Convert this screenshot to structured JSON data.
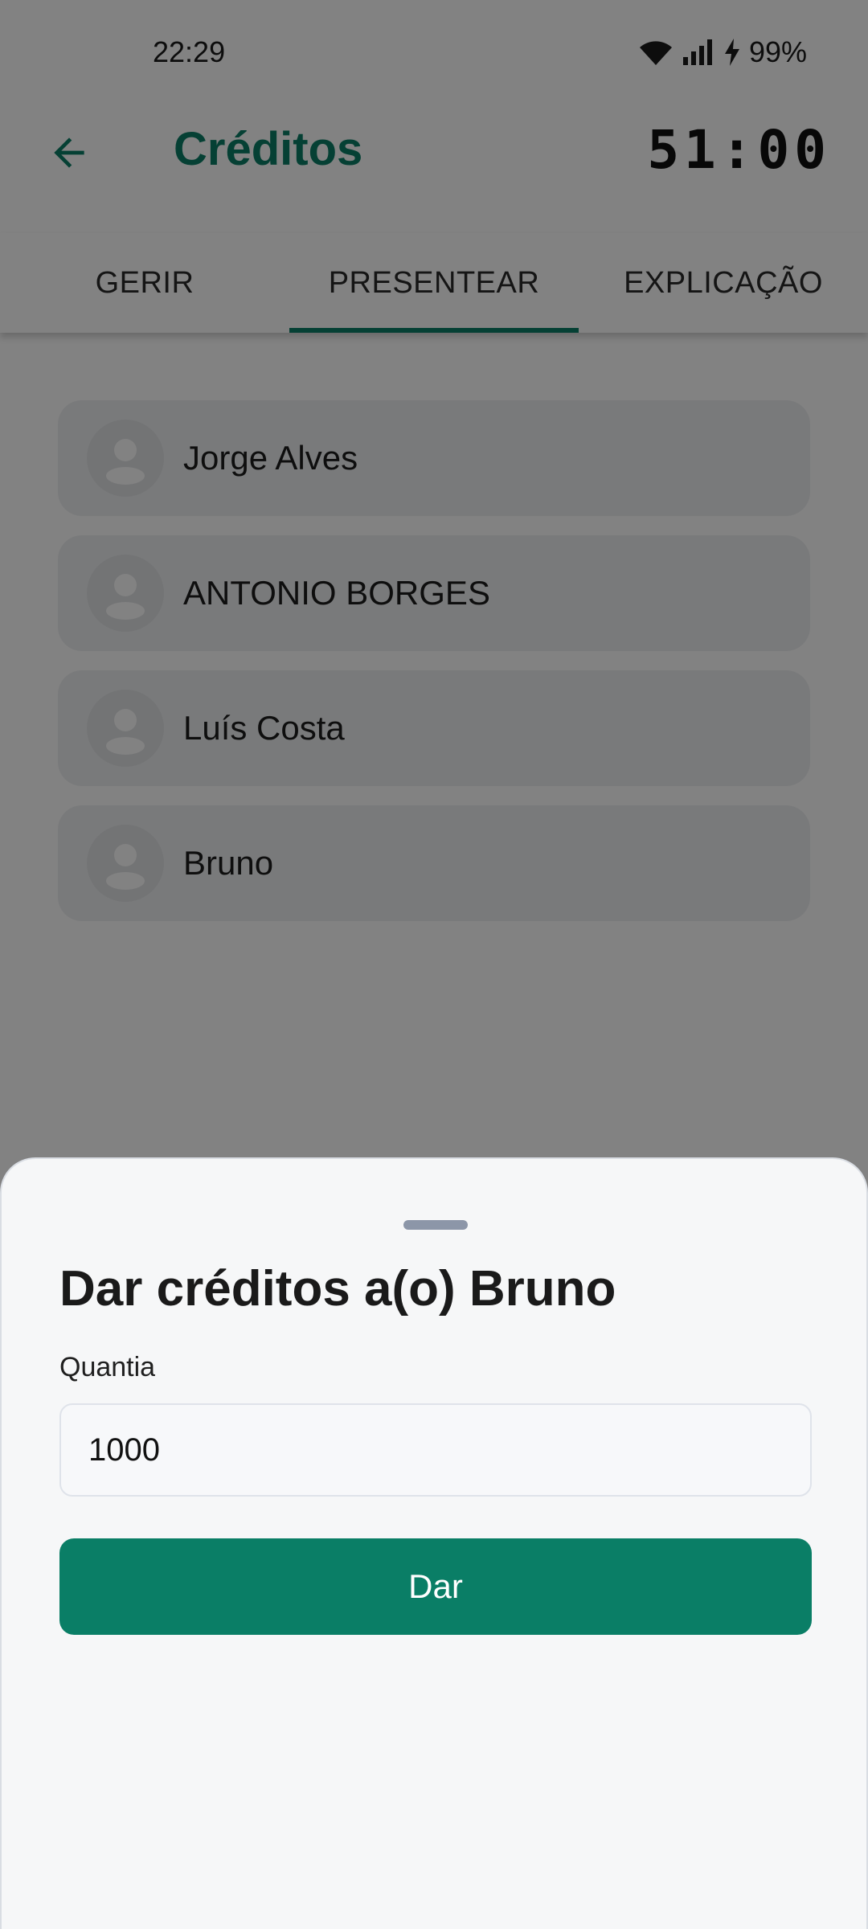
{
  "status_bar": {
    "time": "22:29",
    "battery": "99%",
    "icons": [
      "wifi-icon",
      "signal-icon",
      "charging-icon"
    ]
  },
  "app_bar": {
    "title": "Créditos",
    "timer": "51:00",
    "back_icon": "arrow-left-icon"
  },
  "tabs": [
    {
      "label": "GERIR",
      "selected": false
    },
    {
      "label": "PRESENTEAR",
      "selected": true
    },
    {
      "label": "EXPLICAÇÃO",
      "selected": false
    }
  ],
  "users": [
    {
      "name": "Jorge Alves"
    },
    {
      "name": "ANTONIO BORGES"
    },
    {
      "name": "Luís Costa"
    },
    {
      "name": "Bruno"
    }
  ],
  "sheet": {
    "title": "Dar créditos a(o) Bruno",
    "amount_label": "Quantia",
    "amount_value": "1000",
    "submit_label": "Dar"
  },
  "colors": {
    "accent": "#0a7e66",
    "list_item_bg": "#eef0f2",
    "sheet_bg": "#f6f7f8"
  }
}
